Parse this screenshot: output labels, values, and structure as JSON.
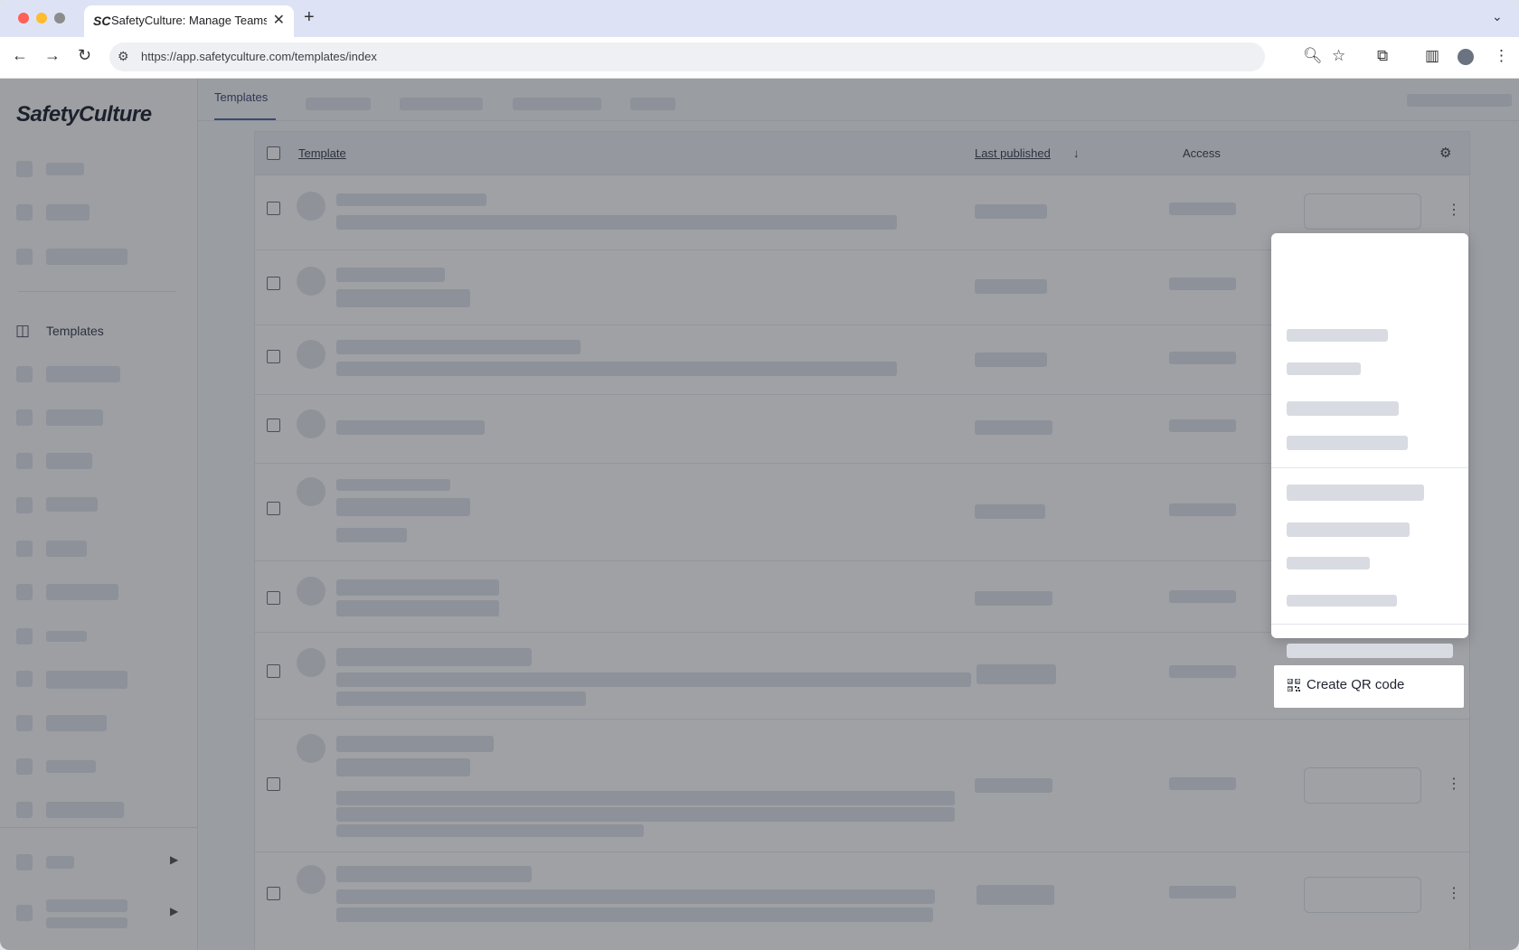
{
  "browser": {
    "tab_title": "SafetyCulture: Manage Teams and...",
    "tab_favicon": "SC",
    "url": "https://app.safetyculture.com/templates/index",
    "traffic_lights": [
      "#fe5f57",
      "#febc2e",
      "#8c8c8c"
    ],
    "icons": [
      "back-icon",
      "forward-icon",
      "reload-icon",
      "site-settings-icon",
      "zoom-icon",
      "bookmark-star-icon",
      "extensions-icon",
      "side-panel-icon",
      "profile-icon",
      "more-icon"
    ]
  },
  "app": {
    "logo": "SafetyCulture",
    "sidebar_active": "Templates",
    "top_tab_active": "Templates",
    "table_headers": {
      "template": "Template",
      "last_published": "Last published",
      "access": "Access"
    },
    "menu_item": {
      "label": "Create QR code",
      "icon": "qr-code-icon"
    },
    "accent_color": "#5468a8"
  }
}
